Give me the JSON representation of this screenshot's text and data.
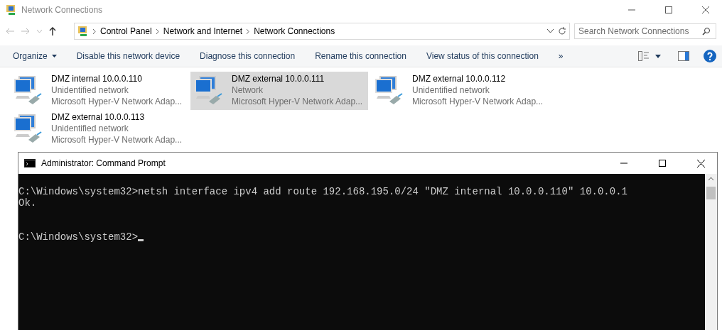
{
  "window": {
    "title": "Network Connections"
  },
  "address_bar": {
    "breadcrumbs": [
      "Control Panel",
      "Network and Internet",
      "Network Connections"
    ]
  },
  "search": {
    "placeholder": "Search Network Connections"
  },
  "command_bar": {
    "organize": "Organize",
    "commands": [
      "Disable this network device",
      "Diagnose this connection",
      "Rename this connection",
      "View status of this connection"
    ],
    "more": "»"
  },
  "connections": [
    {
      "name": "DMZ internal 10.0.0.110",
      "status": "Unidentified network",
      "adapter": "Microsoft Hyper-V Network Adap...",
      "selected": false
    },
    {
      "name": "DMZ external 10.0.0.111",
      "status": "Network",
      "adapter": "Microsoft Hyper-V Network Adap...",
      "selected": true
    },
    {
      "name": "DMZ external 10.0.0.112",
      "status": "Unidentified network",
      "adapter": "Microsoft Hyper-V Network Adap...",
      "selected": false
    },
    {
      "name": "DMZ external 10.0.0.113",
      "status": "Unidentified network",
      "adapter": "Microsoft Hyper-V Network Adap...",
      "selected": false
    }
  ],
  "console_window": {
    "title": "Administrator: Command Prompt",
    "lines": [
      "C:\\Windows\\system32>netsh interface ipv4 add route 192.168.195.0/24 \"DMZ internal 10.0.0.110\" 10.0.0.1",
      "Ok."
    ],
    "prompt": "C:\\Windows\\system32>",
    "cursor": true
  }
}
